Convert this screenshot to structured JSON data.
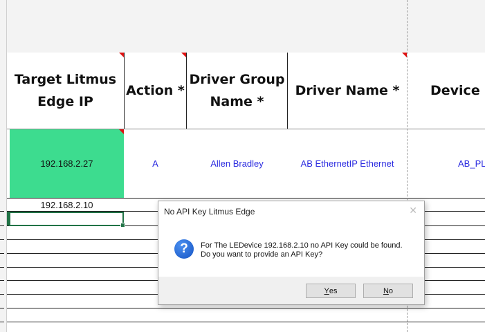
{
  "spreadsheet": {
    "headers": {
      "target_ip_line1": "Target Litmus",
      "target_ip_line2": "Edge IP",
      "action": "Action *",
      "driver_group_line1": "Driver Group",
      "driver_group_line2": "Name *",
      "driver_name": "Driver Name *",
      "device": "Device N"
    },
    "row1": {
      "target_ip": "192.168.2.27",
      "action": "A",
      "driver_group": "Allen Bradley",
      "driver_name": "AB EthernetIP Ethernet",
      "device": "AB_PL"
    },
    "row2": {
      "target_ip": "192.168.2.10"
    },
    "colors": {
      "highlight_cell": "#3ddc8f",
      "selection": "#217346",
      "cell_text": "#2b2be0",
      "comment_marker": "#d11111"
    }
  },
  "dialog": {
    "title": "No API Key Litmus Edge",
    "close_glyph": "✕",
    "icon": "question-icon",
    "icon_glyph": "?",
    "message_line1": "For The LEDevice 192.168.2.10 no API Key could be found.",
    "message_line2": "Do you want to provide an API Key?",
    "yes_hotkey": "Y",
    "yes_rest": "es",
    "no_hotkey": "N",
    "no_rest": "o"
  }
}
